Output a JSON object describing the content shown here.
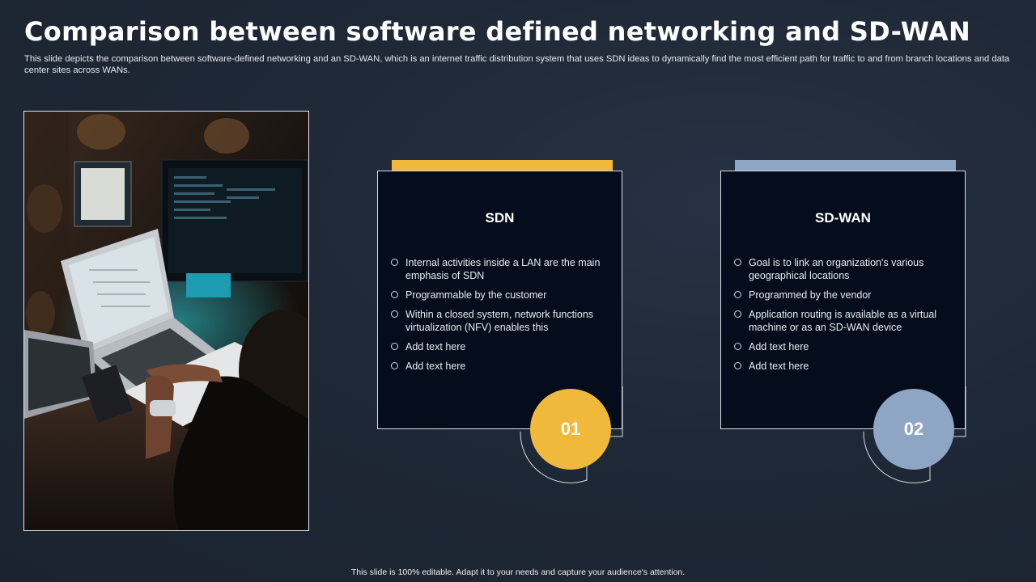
{
  "slide": {
    "title": "Comparison between software defined networking and SD-WAN",
    "subtitle": "This slide depicts the comparison between software-defined networking and an SD-WAN, which is an internet traffic distribution system that uses SDN ideas to dynamically find the most efficient path for traffic to and from branch locations and data center sites across WANs.",
    "footer": "This slide is 100% editable. Adapt it to your needs and capture your audience's attention."
  },
  "colors": {
    "background": "#1f2836",
    "card": "#050c1c",
    "sdn_accent": "#f0b93b",
    "sdwan_accent": "#8fa5c4"
  },
  "cards": [
    {
      "title": "SDN",
      "number": "01",
      "accent": "#f0b93b",
      "bullets": [
        "Internal activities inside a LAN are the main emphasis of SDN",
        "Programmable  by the customer",
        "Within a closed system, network functions virtualization (NFV) enables this",
        "Add text here",
        "Add text here"
      ]
    },
    {
      "title": "SD-WAN",
      "number": "02",
      "accent": "#8fa5c4",
      "bullets": [
        "Goal is to link an organization's various geographical locations",
        "Programmed  by the vendor",
        "Application routing is available  as a virtual machine or as an SD-WAN device",
        "Add text here",
        "Add text here"
      ]
    }
  ]
}
